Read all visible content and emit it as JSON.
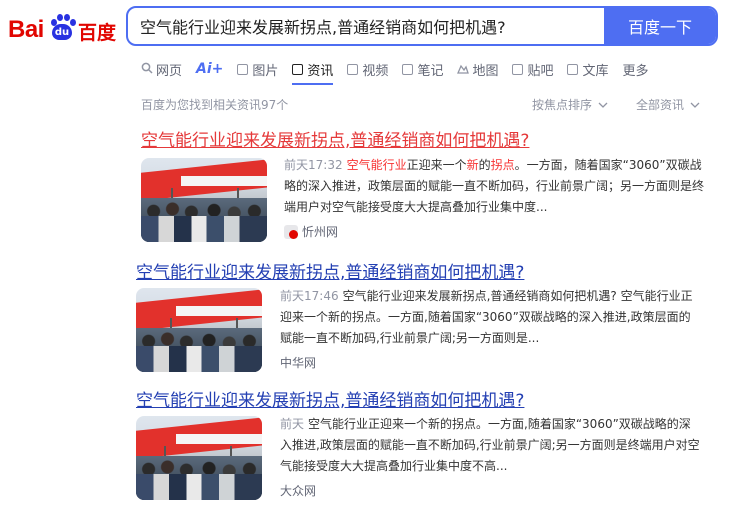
{
  "logo": {
    "part1": "Bai",
    "paw_text": "du",
    "part2": "百度"
  },
  "search": {
    "query": "空气能行业迎来发展新拐点,普通经销商如何把机遇?",
    "button_label": "百度一下"
  },
  "tabs": [
    {
      "icon": "search-icon",
      "label": "网页",
      "active": false
    },
    {
      "icon": "ai-icon",
      "label": "Ai+",
      "active": false
    },
    {
      "icon": "image-icon",
      "label": "图片",
      "active": false
    },
    {
      "icon": "news-icon",
      "label": "资讯",
      "active": true
    },
    {
      "icon": "video-icon",
      "label": "视频",
      "active": false
    },
    {
      "icon": "note-icon",
      "label": "笔记",
      "active": false
    },
    {
      "icon": "map-icon",
      "label": "地图",
      "active": false
    },
    {
      "icon": "tieba-icon",
      "label": "贴吧",
      "active": false
    },
    {
      "icon": "library-icon",
      "label": "文库",
      "active": false
    },
    {
      "icon": "",
      "label": "更多",
      "active": false
    }
  ],
  "meta": {
    "count_text": "百度为您找到相关资讯97个",
    "sort_label": "按焦点排序",
    "filter_label": "全部资讯"
  },
  "results": [
    {
      "title": "空气能行业迎来发展新拐点,普通经销商如何把机遇?",
      "time": "前天17:32",
      "snippet_parts": [
        "空气能行业",
        "正迎来一个",
        "新",
        "的",
        "拐点",
        "。一方面，随着国家“3060”双碳战略的深入推进，政策层面的赋能一直不断加码，行业前景广阔；另一方面则是终端用户对空气能接受度大大提高叠加行业集中度..."
      ],
      "source": "忻州网"
    },
    {
      "title": "空气能行业迎来发展新拐点,普通经销商如何把机遇?",
      "time": "前天17:46",
      "snippet": "空气能行业迎来发展新拐点,普通经销商如何把机遇? 空气能行业正迎来一个新的拐点。一方面,随着国家“3060”双碳战略的深入推进,政策层面的赋能一直不断加码,行业前景广阔;另一方面则是...",
      "source": "中华网"
    },
    {
      "title": "空气能行业迎来发展新拐点,普通经销商如何把机遇?",
      "time": "前天",
      "snippet": "空气能行业正迎来一个新的拐点。一方面,随着国家“3060”双碳战略的深入推进,政策层面的赋能一直不断加码,行业前景广阔;另一方面则是终端用户对空气能接受度大大提高叠加行业集中度不高...",
      "source": "大众网"
    }
  ],
  "colors": {
    "accent": "#4e6ef2",
    "link": "#2440b3",
    "visited_title": "#e5393a",
    "highlight": "#f73131",
    "brand_red": "#e10601",
    "brand_blue": "#2932e1"
  }
}
